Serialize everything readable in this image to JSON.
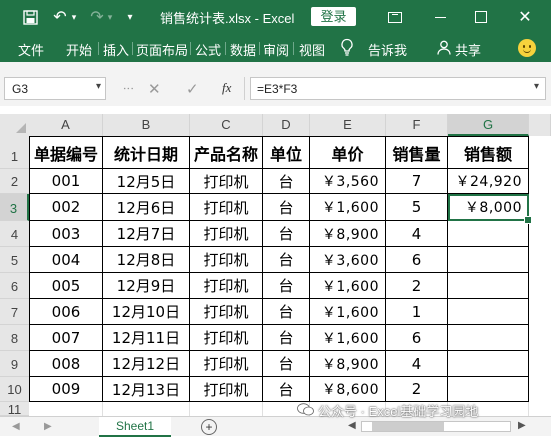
{
  "titlebar": {
    "filename": "销售统计表.xlsx",
    "separator": "-",
    "app": "Excel",
    "login": "登录",
    "close": "✕"
  },
  "ribbon": {
    "tabs": [
      "文件",
      "开始",
      "插入",
      "页面布局",
      "公式",
      "数据",
      "审阅",
      "视图"
    ],
    "tell_me": "告诉我",
    "share": "共享"
  },
  "formula_bar": {
    "name_box": "G3",
    "fx": "fx",
    "formula": "=E3*F3"
  },
  "grid": {
    "columns": [
      "A",
      "B",
      "C",
      "D",
      "E",
      "F",
      "G"
    ],
    "selected_column": "G",
    "row_numbers": [
      "1",
      "2",
      "3",
      "4",
      "5",
      "6",
      "7",
      "8",
      "9",
      "10",
      "11"
    ],
    "selected_row": "3",
    "headers": [
      "单据编号",
      "统计日期",
      "产品名称",
      "单位",
      "单价",
      "销售量",
      "销售额"
    ],
    "rows": [
      [
        "001",
        "12月5日",
        "打印机",
        "台",
        "￥3,560",
        "7",
        "￥24,920"
      ],
      [
        "002",
        "12月6日",
        "打印机",
        "台",
        "￥1,600",
        "5",
        "￥8,000"
      ],
      [
        "003",
        "12月7日",
        "打印机",
        "台",
        "￥8,900",
        "4",
        ""
      ],
      [
        "004",
        "12月8日",
        "打印机",
        "台",
        "￥3,600",
        "6",
        ""
      ],
      [
        "005",
        "12月9日",
        "打印机",
        "台",
        "￥1,600",
        "2",
        ""
      ],
      [
        "006",
        "12月10日",
        "打印机",
        "台",
        "￥1,600",
        "1",
        ""
      ],
      [
        "007",
        "12月11日",
        "打印机",
        "台",
        "￥1,600",
        "6",
        ""
      ],
      [
        "008",
        "12月12日",
        "打印机",
        "台",
        "￥8,900",
        "4",
        ""
      ],
      [
        "009",
        "12月13日",
        "打印机",
        "台",
        "￥8,600",
        "2",
        ""
      ]
    ]
  },
  "sheets": {
    "active": "Sheet1",
    "add": "+"
  },
  "watermark": "公众号 · Excel基础学习园地",
  "colors": {
    "accent": "#217346",
    "header_bg": "#e6e6e6",
    "selected_header_bg": "#d3d3d3"
  },
  "icons": [
    "save-icon",
    "undo-icon",
    "redo-icon",
    "customize-qat-icon",
    "ribbon-display-options-icon",
    "minimize-icon",
    "maximize-icon",
    "close-icon",
    "lightbulb-icon",
    "share-icon",
    "smiley-icon",
    "cancel-icon",
    "enter-icon",
    "function-icon",
    "add-sheet-icon"
  ]
}
